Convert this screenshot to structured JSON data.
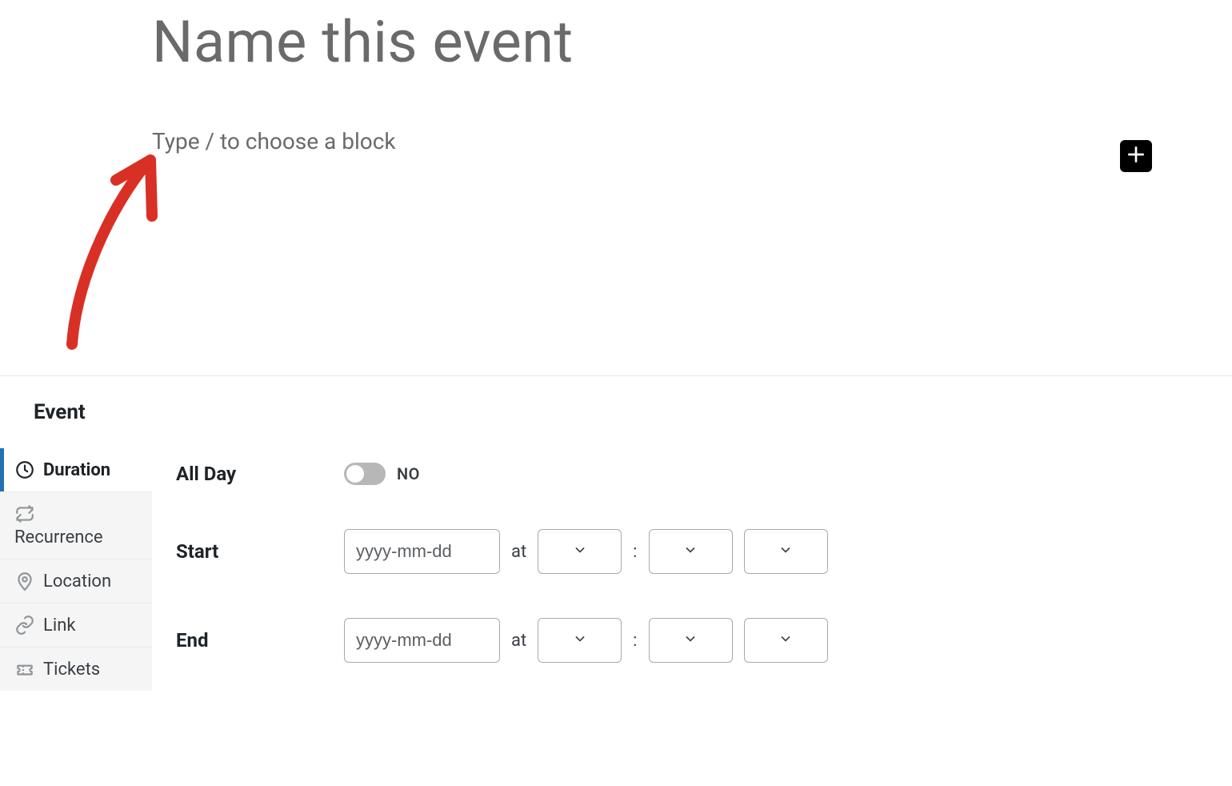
{
  "editor": {
    "title_placeholder": "Name this event",
    "block_placeholder": "Type / to choose a block"
  },
  "panel": {
    "title": "Event",
    "tabs": [
      {
        "id": "duration",
        "label": "Duration",
        "icon": "clock",
        "active": true
      },
      {
        "id": "recurrence",
        "label": "Recurrence",
        "icon": "repeat",
        "active": false
      },
      {
        "id": "location",
        "label": "Location",
        "icon": "pin",
        "active": false
      },
      {
        "id": "link",
        "label": "Link",
        "icon": "link",
        "active": false
      },
      {
        "id": "tickets",
        "label": "Tickets",
        "icon": "ticket",
        "active": false
      }
    ]
  },
  "form": {
    "allday_label": "All Day",
    "allday_value": "NO",
    "start_label": "Start",
    "end_label": "End",
    "date_placeholder": "yyyy-mm-dd",
    "at_label": "at",
    "colon": ":"
  }
}
